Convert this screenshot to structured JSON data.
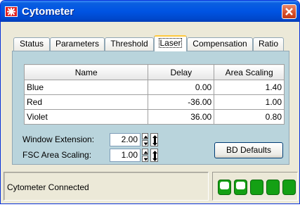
{
  "window": {
    "title": "Cytometer",
    "icon": "app-star-icon",
    "close_icon": "close-icon"
  },
  "tabs": [
    {
      "label": "Status",
      "active": false
    },
    {
      "label": "Parameters",
      "active": false
    },
    {
      "label": "Threshold",
      "active": false
    },
    {
      "label": "Laser",
      "active": true
    },
    {
      "label": "Compensation",
      "active": false
    },
    {
      "label": "Ratio",
      "active": false
    }
  ],
  "laser_table": {
    "columns": [
      "Name",
      "Delay",
      "Area Scaling"
    ],
    "rows": [
      {
        "name": "Blue",
        "delay": "0.00",
        "area_scaling": "1.40"
      },
      {
        "name": "Red",
        "delay": "-36.00",
        "area_scaling": "1.00"
      },
      {
        "name": "Violet",
        "delay": "36.00",
        "area_scaling": "0.80"
      }
    ]
  },
  "fields": {
    "window_extension": {
      "label": "Window Extension:",
      "value": "2.00"
    },
    "fsc_area_scaling": {
      "label": "FSC Area Scaling:",
      "value": "1.00"
    }
  },
  "buttons": {
    "bd_defaults": "BD Defaults"
  },
  "status": {
    "text": "Cytometer Connected",
    "lights": [
      {
        "state": "on"
      },
      {
        "state": "on"
      },
      {
        "state": "off"
      },
      {
        "state": "off"
      },
      {
        "state": "off"
      }
    ],
    "light_color": "#14A014"
  }
}
